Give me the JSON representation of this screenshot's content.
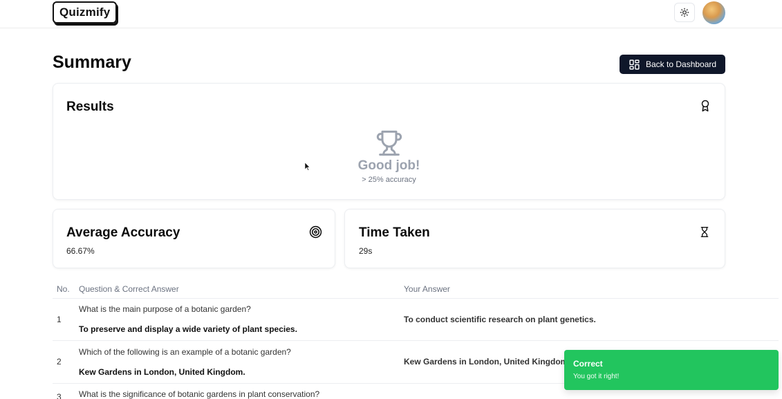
{
  "app": {
    "name": "Quizmify"
  },
  "page": {
    "title": "Summary",
    "back_button_label": "Back to Dashboard"
  },
  "results": {
    "title": "Results",
    "heading": "Good job!",
    "subtitle": "> 25% accuracy"
  },
  "accuracy": {
    "title": "Average Accuracy",
    "value": "66.67%"
  },
  "time": {
    "title": "Time Taken",
    "value": "29s"
  },
  "table": {
    "columns": [
      "No.",
      "Question & Correct Answer",
      "Your Answer"
    ],
    "rows": [
      {
        "no": "1",
        "question": "What is the main purpose of a botanic garden?",
        "correct": "To preserve and display a wide variety of plant species.",
        "user_answer": "To conduct scientific research on plant genetics.",
        "is_correct": false
      },
      {
        "no": "2",
        "question": "Which of the following is an example of a botanic garden?",
        "correct": "Kew Gardens in London, United Kingdom.",
        "user_answer": "Kew Gardens in London, United Kingdom.",
        "is_correct": true
      },
      {
        "no": "3",
        "question": "What is the significance of botanic gardens in plant conservation?",
        "correct": "",
        "user_answer": "",
        "is_correct": null
      }
    ]
  },
  "toast": {
    "title": "Correct",
    "description": "You got it right!"
  },
  "colors": {
    "primary": "#0f172a",
    "wrong": "#c0313e",
    "right": "#22a34a",
    "toast": "#22c55e"
  },
  "icons": {
    "theme_toggle": "sun-icon",
    "back_button": "layout-dashboard-icon",
    "results": "award-icon",
    "trophy": "trophy-icon",
    "accuracy": "target-icon",
    "time": "hourglass-icon"
  }
}
